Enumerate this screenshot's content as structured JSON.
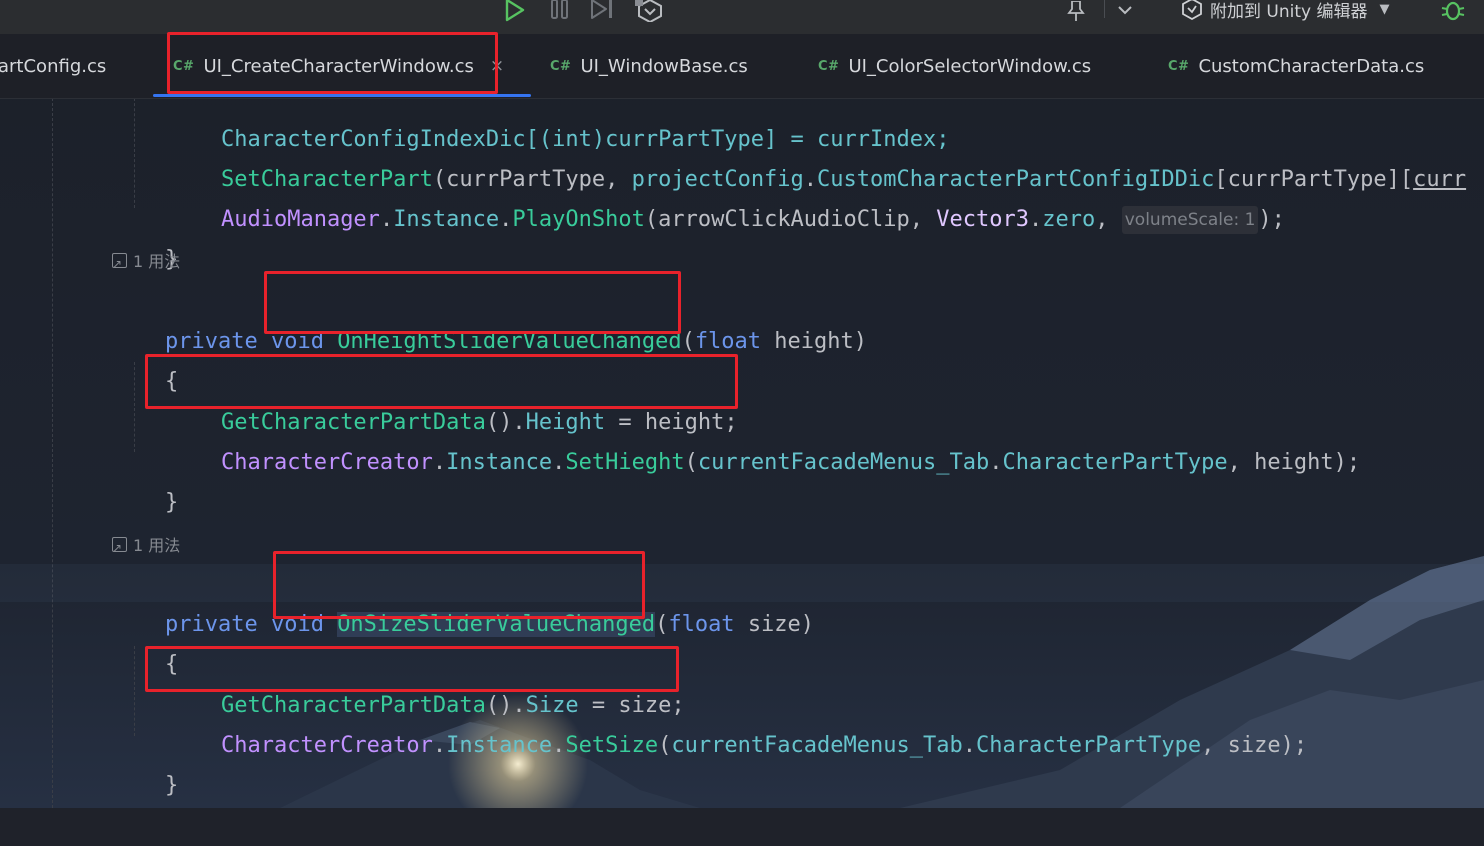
{
  "toolbar": {
    "attach_label": "附加到 Unity 编辑器",
    "icons": [
      "run-icon",
      "pause-icon",
      "step-icon",
      "debug-unity-icon",
      "pin-icon",
      "chevron-down-icon",
      "unity-attach-icon",
      "bug-icon"
    ]
  },
  "tabs": [
    {
      "lang": "",
      "label": "artConfig.cs",
      "active": false
    },
    {
      "lang": "C#",
      "label": "UI_CreateCharacterWindow.cs",
      "active": true,
      "close": "×"
    },
    {
      "lang": "C#",
      "label": "UI_WindowBase.cs",
      "active": false
    },
    {
      "lang": "C#",
      "label": "UI_ColorSelectorWindow.cs",
      "active": false
    },
    {
      "lang": "C#",
      "label": "CustomCharacterData.cs",
      "active": false
    }
  ],
  "code": {
    "line0": "CharacterConfigIndexDic[(int)currPartType] = currIndex;",
    "line1": {
      "call": "SetCharacterPart",
      "arg1": "currPartType",
      "obj": "projectConfig",
      "dict": "CustomCharacterPartConfigIDDic",
      "idx": "currPartType",
      "tail": "curr"
    },
    "line2": {
      "cls": "AudioManager",
      "inst": "Instance",
      "call": "PlayOnShot",
      "arg1": "arrowClickAudioClip",
      "vec": "Vector3",
      "zero": "zero",
      "hint_label": "volumeScale:",
      "hint_value": "1"
    },
    "close1": "}",
    "usage1": "1 用法",
    "method1": {
      "mod": "private",
      "ret": "void",
      "name": "OnHeightSliderValueChanged",
      "ptype": "float",
      "pname": "height"
    },
    "open2": "{",
    "m1_line1": {
      "call": "GetCharacterPartData",
      "prop": "Height",
      "val": "height"
    },
    "m1_line2": {
      "cls": "CharacterCreator",
      "inst": "Instance",
      "call": "SetHieght",
      "obj": "currentFacadeMenus_Tab",
      "prop": "CharacterPartType",
      "arg": "height"
    },
    "close2": "}",
    "usage2": "1 用法",
    "method2": {
      "mod": "private",
      "ret": "void",
      "name": "OnSizeSliderValueChanged",
      "ptype": "float",
      "pname": "size"
    },
    "open3": "{",
    "m2_line1": {
      "call": "GetCharacterPartData",
      "prop": "Size",
      "val": "size"
    },
    "m2_line2": {
      "cls": "CharacterCreator",
      "inst": "Instance",
      "call": "SetSize",
      "obj": "currentFacadeMenus_Tab",
      "prop": "CharacterPartType",
      "arg": "size"
    },
    "close3": "}"
  },
  "colors": {
    "annotation_red": "#e8222b",
    "active_tab_underline": "#3574f0",
    "run_green": "#57c261"
  }
}
